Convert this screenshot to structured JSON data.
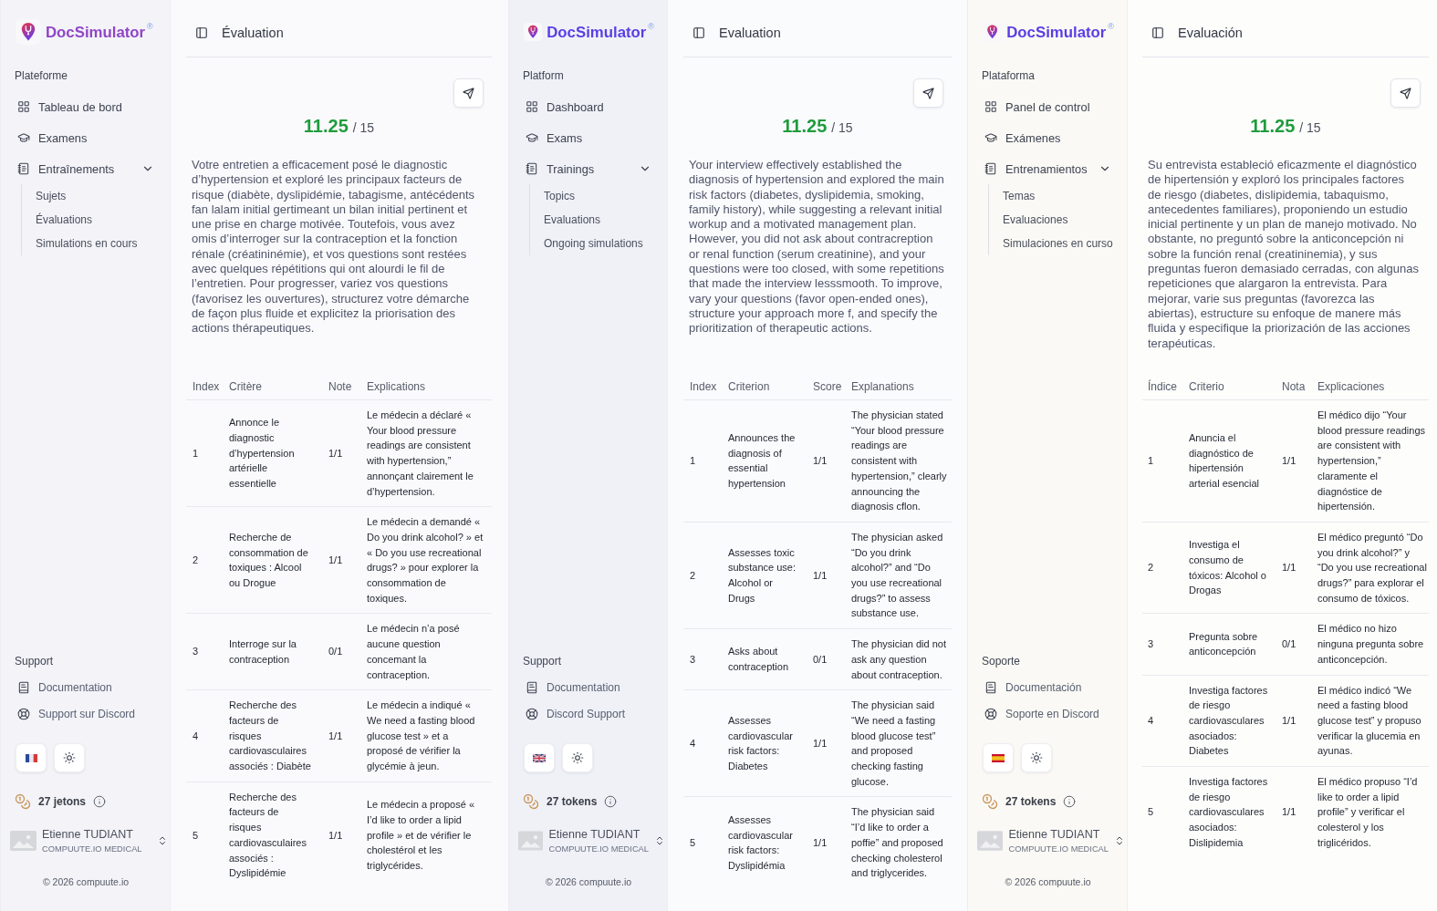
{
  "panels": [
    {
      "kind": "french",
      "sidebar": {
        "brand": "DocSimulator$^{®}$",
        "platform_label": "Plateforme",
        "nav": [
          {
            "label": "Tableau de bord"
          },
          {
            "label": "Examens"
          },
          {
            "label": "Entraînements",
            "expanded": true,
            "children": [
              {
                "label": "Sujets"
              },
              {
                "label": "Évaluations"
              },
              {
                "label": "Simulations en cours"
              }
            ]
          }
        ],
        "support_label": "Support",
        "support_links": [
          {
            "label": "Documentation"
          },
          {
            "label": "Support sur Discord"
          }
        ],
        "tokens": "27 jetons",
        "user": {
          "name": "Etienne TUDIANT",
          "org": "COMPUUTE.IO MEDICAL"
        },
        "copyright": "© 2026 compuute.io"
      },
      "main": {
        "title": "Évaluation",
        "score": "11.25",
        "score_total": "/ 15",
        "summary": "Votre entretien a efficacement posé le diagnostic d’hypertension et exploré les principaux facteurs de risque (diabète, dyslipidémie, tabagisme, antécédents fan lalam initial gertimeant un bilan initial pertinent et une prise en charge motivée. Toutefois, vous avez omis d’interroger sur la contraception et la fonction rénale (créatininémie), et vos questions sont restées avec quelques répétitions qui ont alourdi le fil de l’entretien. Pour progresser, variez vos questions (favorisez les ouvertures), structurez votre démarche de façon plus fluide et explicitez la priorisation des actions thérapeutiques.",
        "table": {
          "columns": [
            "Index",
            "Critère",
            "Note",
            "Explications"
          ],
          "rows": [
            {
              "index": "1",
              "criterion": "Annonce le diagnostic d’hypertension artérielle essentielle",
              "score": "1/1",
              "explanation": "Le médecin a déclaré « Your blood pressure readings are consistent with hypertension,” annonçant clairement le d’hypertension."
            },
            {
              "index": "2",
              "criterion": "Recherche de consommation de toxiques : Alcool ou Drogue",
              "score": "1/1",
              "explanation": "Le médecin a demandé « Do you drink alcohol? » et « Do you use recreational drugs? » pour explorer la consommation de toxiques."
            },
            {
              "index": "3",
              "criterion": "Interroge sur la contraception",
              "score": "0/1",
              "explanation": "Le médecin n’a posé aucune question concemant la contraception."
            },
            {
              "index": "4",
              "criterion": "Recherche des facteurs de risques cardiovasculaires associés : Diabète",
              "score": "1/1",
              "explanation": "Le médecin a indiqué « We need a fasting blood glucose test » et a proposé de vérifier la glycémie à jeun."
            },
            {
              "index": "5",
              "criterion": "Recherche des facteurs de risques cardiovasculaires associés : Dyslipidémie",
              "score": "1/1",
              "explanation": "Le médecin a proposé « I’d like to order a lipid profile » et de vérifier le cholestérol et les triglycérides."
            }
          ]
        }
      }
    },
    {
      "kind": "english",
      "sidebar": {
        "brand": "DocSimulator$^{®}$",
        "platform_label": "Platform",
        "nav": [
          {
            "label": "Dashboard"
          },
          {
            "label": "Exams"
          },
          {
            "label": "Trainings",
            "expanded": true,
            "children": [
              {
                "label": "Topics"
              },
              {
                "label": "Evaluations"
              },
              {
                "label": "Ongoing simulations"
              }
            ]
          }
        ],
        "support_label": "Support",
        "support_links": [
          {
            "label": "Documentation"
          },
          {
            "label": "Discord Support"
          }
        ],
        "tokens": "27 tokens",
        "user": {
          "name": "Etienne TUDIANT",
          "org": "COMPUUTE.IO MEDICAL"
        },
        "copyright": "© 2026 compuute.io"
      },
      "main": {
        "title": "Evaluation",
        "score": "11.25",
        "score_total": "/ 15",
        "summary": "Your interview effectively established the diagnosis of hypertension and explored the main risk factors (diabetes, dyslipidemia, smoking, family history), while suggesting a relevant initial workup and a motivated management plan. However, you did not ask about contracreption or renal function (serum creatinine), and your questions were too closed, with some repetitions that made the interview lesssmooth. To improve, vary your questions (favor open-ended ones), structure your approach more f, and specify the prioritization of therapeutic actions.",
        "table": {
          "columns": [
            "Index",
            "Criterion",
            "Score",
            "Explanations"
          ],
          "rows": [
            {
              "index": "1",
              "criterion": "Announces the diagnosis of essential hypertension",
              "score": "1/1",
              "explanation": "The physician stated “Your blood pressure readings are consistent with hypertension,” clearly announcing the diagnosis cflon."
            },
            {
              "index": "2",
              "criterion": "Assesses toxic substance use: Alcohol or Drugs",
              "score": "1/1",
              "explanation": "The physician asked “Do you drink alcohol?” and “Do you use recreational drugs?” to assess substance use."
            },
            {
              "index": "3",
              "criterion": "Asks about contraception",
              "score": "0/1",
              "explanation": "The physician did not ask any question about contraception."
            },
            {
              "index": "4",
              "criterion": "Assesses cardiovascular risk factors: Diabetes",
              "score": "1/1",
              "explanation": "The physician said “We need a fasting blood glucose test” and proposed checking fasting glucose."
            },
            {
              "index": "5",
              "criterion": "Assesses cardiovascular risk factors: Dyslipidémia",
              "score": "1/1",
              "explanation": "The physician said “I’d like to order a poffie” and proposed checking cholesterol and triglycerides."
            }
          ]
        }
      }
    },
    {
      "kind": "spanish",
      "sidebar": {
        "brand": "DocSimulator$^{®}$",
        "platform_label": "Plataforma",
        "nav": [
          {
            "label": "Panel de control"
          },
          {
            "label": "Exámenes"
          },
          {
            "label": "Entrenamientos",
            "expanded": true,
            "children": [
              {
                "label": "Temas"
              },
              {
                "label": "Evaluaciones"
              },
              {
                "label": "Simulaciones en curso"
              }
            ]
          }
        ],
        "support_label": "Soporte",
        "support_links": [
          {
            "label": "Documentación"
          },
          {
            "label": "Soporte en Discord"
          }
        ],
        "tokens": "27 tokens",
        "user": {
          "name": "Etienne TUDIANT",
          "org": "COMPUUTE.IO MEDICAL"
        },
        "copyright": "© 2026 compuute.io"
      },
      "main": {
        "title": "Evaluación",
        "score": "11.25",
        "score_total": "/ 15",
        "summary": "Su entrevista estableció eficazmente el diagnóstico de hipertensión y exploró los principales factores de riesgo (diabetes, dislipidemia, tabaquismo, antecedentes familiares), proponiendo un estudio inicial pertinente y un plan de manejo motivado. No obstante, no preguntó sobre la anticoncepción ni sobre la función renal (creatininemia), y sus preguntas fueron demasiado cerradas, con algunas repeticiones que alargaron la entrevista. Para mejorar, varie sus preguntas (favorezca las abiertas), estructure su enfoque de manere más fluida y especifique la priorización de las acciones terapéuticas.",
        "table": {
          "columns": [
            "Índice",
            "Criterio",
            "Nota",
            "Explicaciones"
          ],
          "rows": [
            {
              "index": "1",
              "criterion": "Anuncia el diagnóstico de hipertensión arterial esencial",
              "score": "1/1",
              "explanation": "El médico dijo “Your blood pressure readings are consistent with hypertension,” claramente el diagnóstice de hipertensión."
            },
            {
              "index": "2",
              "criterion": "Investiga el consumo de tóxicos: Alcohol o Drogas",
              "score": "1/1",
              "explanation": "El médico preguntó “Do you drink alcohol?” y “Do you use recreational drugs?” para explorar el consumo de tóxicos."
            },
            {
              "index": "3",
              "criterion": "Pregunta sobre anticoncepción",
              "score": "0/1",
              "explanation": "El médico no hizo ninguna pregunta sobre anticoncepción."
            },
            {
              "index": "4",
              "criterion": "Investiga factores de riesgo cardiovasculares asociados: Diabetes",
              "score": "1/1",
              "explanation": "El médico indicó “We need a fasting blood glucose test” y propuso verificar la glucemia en ayunas."
            },
            {
              "index": "5",
              "criterion": "Investiga factores de riesgo cardiovasculares asociados: Dislipidemia",
              "score": "1/1",
              "explanation": "El médico propuso “I’d like to order a lipid profile” y verificar el colesterol y los triglicéridos."
            }
          ]
        }
      }
    }
  ]
}
